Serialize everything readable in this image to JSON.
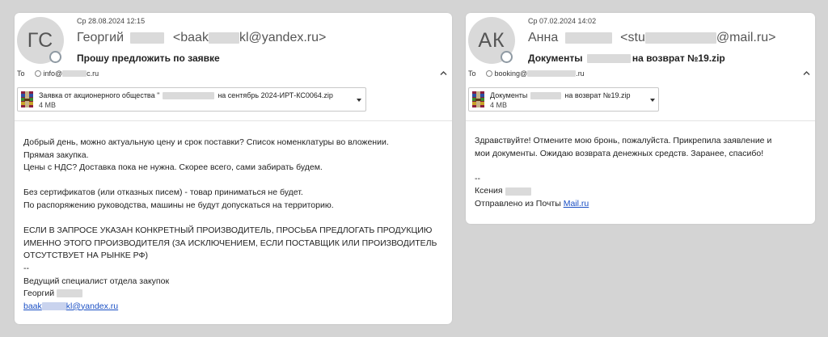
{
  "email1": {
    "avatar_initials": "ГС",
    "date": "Ср 28.08.2024 12:15",
    "sender_name": "Георгий",
    "sender_email_start": "<baak",
    "sender_email_end": "kl@yandex.ru>",
    "subject": "Прошу предложить по заявке",
    "to_label": "To",
    "to_address_start": "info@",
    "to_address_end": "c.ru",
    "attachment": {
      "name_start": "Заявка от акционерного общества \"",
      "name_end": "на сентябрь 2024-ИРТ-КС0064.zip",
      "size": "4 MB",
      "icon": "winrar-archive-icon"
    },
    "body": [
      "Добрый день, можно актуальную цену и срок поставки? Список номенклатуры во вложении.",
      "Прямая закупка.",
      "Цены с НДС? Доставка пока не нужна. Скорее всего, сами забирать будем.",
      "",
      "Без сертификатов (или отказных писем) - товар приниматься не будет.",
      "По распоряжению руководства, машины не будут допускаться на территорию.",
      "",
      "ЕСЛИ В ЗАПРОСЕ УКАЗАН КОНКРЕТНЫЙ ПРОИЗВОДИТЕЛЬ, ПРОСЬБА ПРЕДЛОГАТЬ ПРОДУКЦИЮ",
      "ИМЕННО ЭТОГО ПРОИЗВОДИТЕЛЯ (ЗА ИСКЛЮЧЕНИЕМ, ЕСЛИ ПОСТАВЩИК ИЛИ ПРОИЗВОДИТЕЛЬ",
      "ОТСУТСТВУЕТ НА РЫНКЕ РФ)",
      "--",
      "Ведущий специалист отдела закупок",
      "Георгий"
    ],
    "signature_link_start": "baak",
    "signature_link_end": "kl@yandex.ru"
  },
  "email2": {
    "avatar_initials": "АК",
    "date": "Ср 07.02.2024 14:02",
    "sender_name": "Анна",
    "sender_email_start": "<stu",
    "sender_email_end": "@mail.ru>",
    "subject_start": "Документы",
    "subject_end": "на возврат №19.zip",
    "to_label": "To",
    "to_address_start": "booking@",
    "to_address_end": ".ru",
    "attachment": {
      "name_start": "Документы",
      "name_end": "на возврат №19.zip",
      "size": "4 MB",
      "icon": "winrar-archive-icon"
    },
    "body": [
      "Здравствуйте! Отмените мою бронь, пожалуйста. Прикрепила заявление и",
      "мои документы. Ожидаю возврата денежных средств. Заранее, спасибо!",
      "",
      "--",
      "Ксения"
    ],
    "sent_from": "Отправлено из Почты",
    "sent_from_link": "Mail.ru"
  },
  "colors": {
    "background": "#d4d4d4",
    "link": "#1a4fc4",
    "redaction": "#dadada"
  }
}
